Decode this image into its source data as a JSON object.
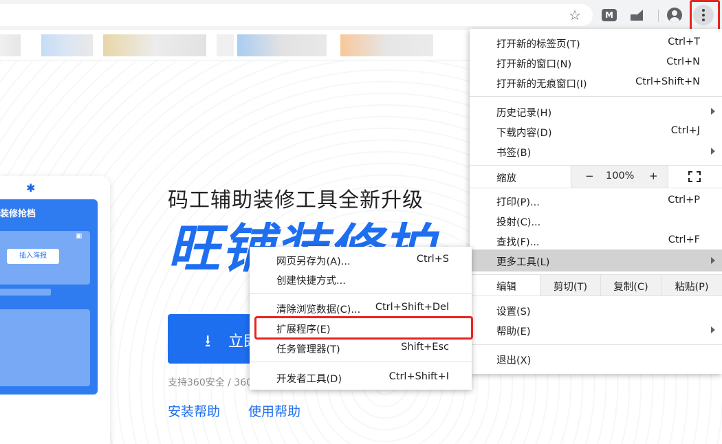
{
  "toolbar": {
    "bookmark_star": "☆",
    "ext1_glyph": "M",
    "ext2_glyph": "◢"
  },
  "page": {
    "mock": {
      "title": "装修抢档",
      "button": "插入海报"
    },
    "subhead": "码工辅助装修工具全新升级",
    "bighead": "旺铺装修拍",
    "download_icon": "⭳",
    "download_label": "立即",
    "support_text": "支持360安全 / 360",
    "links": [
      "安装帮助",
      "使用帮助"
    ]
  },
  "menu": {
    "new_tab": {
      "label": "打开新的标签页(T)",
      "shortcut": "Ctrl+T"
    },
    "new_window": {
      "label": "打开新的窗口(N)",
      "shortcut": "Ctrl+N"
    },
    "incognito": {
      "label": "打开新的无痕窗口(I)",
      "shortcut": "Ctrl+Shift+N"
    },
    "history": {
      "label": "历史记录(H)"
    },
    "downloads": {
      "label": "下载内容(D)",
      "shortcut": "Ctrl+J"
    },
    "bookmarks": {
      "label": "书签(B)"
    },
    "zoom": {
      "label": "缩放",
      "minus": "−",
      "value": "100%",
      "plus": "+"
    },
    "print": {
      "label": "打印(P)...",
      "shortcut": "Ctrl+P"
    },
    "cast": {
      "label": "投射(C)..."
    },
    "find": {
      "label": "查找(F)...",
      "shortcut": "Ctrl+F"
    },
    "more_tools": {
      "label": "更多工具(L)"
    },
    "edit": {
      "label": "编辑",
      "cut": "剪切(T)",
      "copy": "复制(C)",
      "paste": "粘贴(P)"
    },
    "settings": {
      "label": "设置(S)"
    },
    "help": {
      "label": "帮助(E)"
    },
    "exit": {
      "label": "退出(X)"
    }
  },
  "submenu": {
    "save_as": {
      "label": "网页另存为(A)...",
      "shortcut": "Ctrl+S"
    },
    "create_shortcut": {
      "label": "创建快捷方式..."
    },
    "clear_data": {
      "label": "清除浏览数据(C)...",
      "shortcut": "Ctrl+Shift+Del"
    },
    "extensions": {
      "label": "扩展程序(E)"
    },
    "task_manager": {
      "label": "任务管理器(T)",
      "shortcut": "Shift+Esc"
    },
    "dev_tools": {
      "label": "开发者工具(D)",
      "shortcut": "Ctrl+Shift+I"
    }
  },
  "colors": {
    "accent": "#1e6ef0",
    "highlight_red": "#e8231f",
    "menu_hover": "#d2d2d2"
  }
}
